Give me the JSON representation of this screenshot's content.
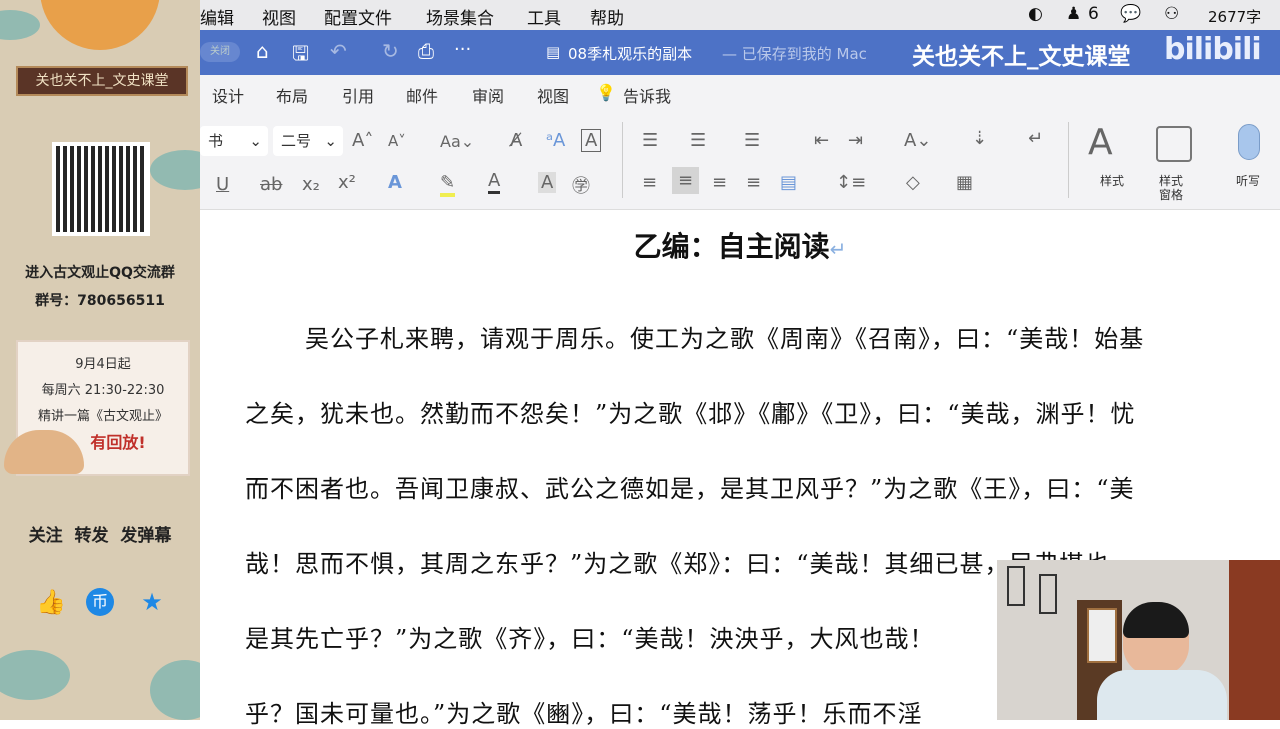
{
  "left_panel": {
    "channel": "关也关不上_文史课堂",
    "qq_line": "进入古文观止QQ交流群",
    "group_no": "群号：780656511",
    "card": {
      "line1": "9月4日起",
      "line2": "每周六 21:30-22:30",
      "line3": "精讲一篇《古文观止》",
      "replay": "有回放!"
    },
    "actions": "关注  转发  发弹幕"
  },
  "menubar": {
    "items": [
      "编辑",
      "视图",
      "配置文件",
      "场景集合",
      "工具",
      "帮助"
    ],
    "qq_count": "6",
    "word_count": "2677字"
  },
  "titlebar": {
    "autosave": "关闭",
    "doc_title": "08季札观乐的副本",
    "saved_status": "— 已保存到我的 Mac",
    "watermark": "关也关不上_文史课堂",
    "logo": "bilibili"
  },
  "tabs": [
    "设计",
    "布局",
    "引用",
    "邮件",
    "审阅",
    "视图"
  ],
  "tell_me": "告诉我",
  "toolbar": {
    "font": "书",
    "size": "二号",
    "styles": "样式",
    "styles_pane_1": "样式",
    "styles_pane_2": "窗格",
    "dictate": "听写"
  },
  "document": {
    "heading": "乙编：自主阅读",
    "lines": [
      "吴公子札来聘，请观于周乐。使工为之歌《周南》《召南》，曰：“美哉！始基",
      "之矣，犹未也。然勤而不怨矣！”为之歌《邶》《鄘》《卫》，曰：“美哉，渊乎！忧",
      "而不困者也。吾闻卫康叔、武公之德如是，是其卫风乎？”为之歌《王》，曰：“美",
      "哉！思而不惧，其周之东乎？”为之歌《郑》：曰：“美哉！其细已甚，民弗堪也，",
      "是其先亡乎？”为之歌《齐》，曰：“美哉！泱泱乎，大风也哉！",
      "乎？国未可量也。”为之歌《豳》，曰：“美哉！荡乎！乐而不淫"
    ]
  }
}
